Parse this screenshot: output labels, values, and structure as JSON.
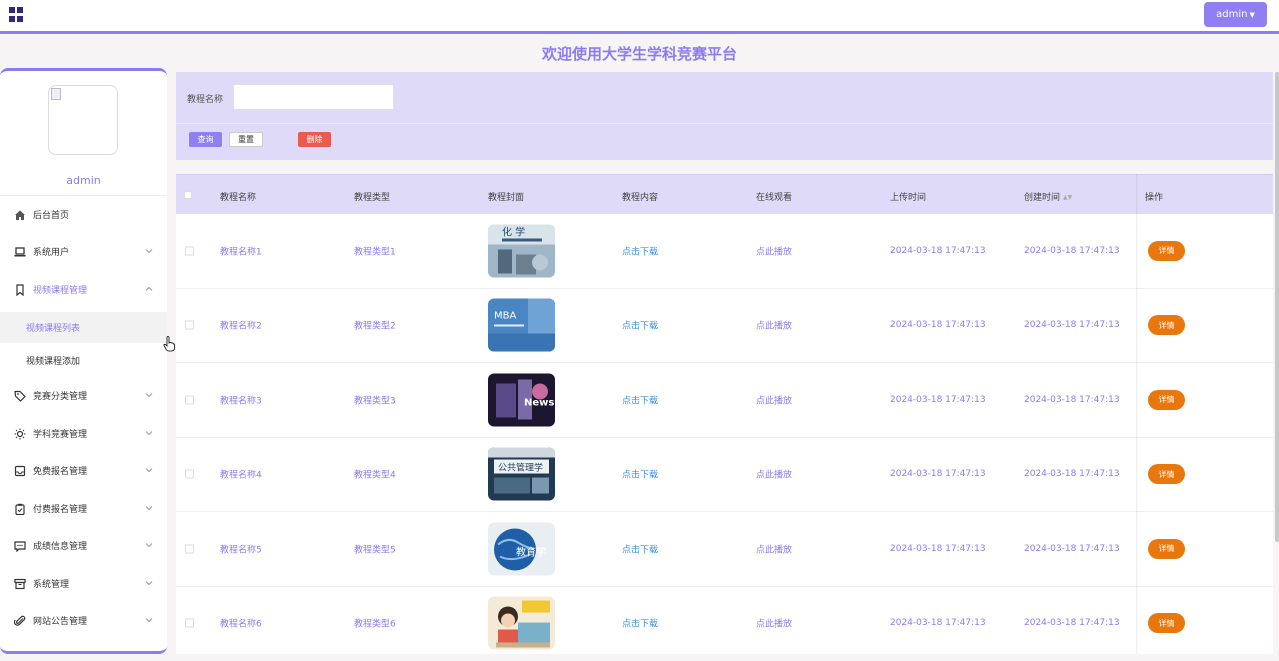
{
  "header": {
    "user_button": "admin",
    "page_title": "欢迎使用大学生学科竞赛平台"
  },
  "sidebar": {
    "username": "admin",
    "items": [
      {
        "label": "后台首页",
        "icon": "home-icon",
        "has_chevron": false
      },
      {
        "label": "系统用户",
        "icon": "laptop-icon",
        "has_chevron": true
      },
      {
        "label": "视频课程管理",
        "icon": "bookmark-icon",
        "has_chevron": true,
        "expanded": true
      },
      {
        "label": "竞赛分类管理",
        "icon": "tag-icon",
        "has_chevron": true
      },
      {
        "label": "学科竞赛管理",
        "icon": "sun-icon",
        "has_chevron": true
      },
      {
        "label": "免费报名管理",
        "icon": "inbox-icon",
        "has_chevron": true
      },
      {
        "label": "付费报名管理",
        "icon": "clipboard-icon",
        "has_chevron": true
      },
      {
        "label": "成绩信息管理",
        "icon": "message-icon",
        "has_chevron": true
      },
      {
        "label": "系统管理",
        "icon": "archive-icon",
        "has_chevron": true
      },
      {
        "label": "网站公告管理",
        "icon": "paperclip-icon",
        "has_chevron": true
      }
    ],
    "subitems": [
      {
        "label": "视频课程列表",
        "current": true
      },
      {
        "label": "视频课程添加",
        "current": false
      }
    ]
  },
  "search": {
    "label": "教程名称",
    "input_value": "",
    "query_label": "查询",
    "reset_label": "重置",
    "delete_label": "删除"
  },
  "table": {
    "headers": [
      "教程名称",
      "教程类型",
      "教程封面",
      "教程内容",
      "在线观看",
      "上传时间",
      "创建时间",
      "操作"
    ],
    "rows": [
      {
        "name": "教程名称1",
        "type": "教程类型1",
        "cover": "chemistry-book-cover",
        "content": "点击下载",
        "watch": "点此播放",
        "upload_time": "2024-03-18 17:47:13",
        "create_time": "2024-03-18 17:47:13",
        "action": "详情"
      },
      {
        "name": "教程名称2",
        "type": "教程类型2",
        "cover": "mba-cover",
        "content": "点击下载",
        "watch": "点此播放",
        "upload_time": "2024-03-18 17:47:13",
        "create_time": "2024-03-18 17:47:13",
        "action": "详情"
      },
      {
        "name": "教程名称3",
        "type": "教程类型3",
        "cover": "news-cover",
        "content": "点击下载",
        "watch": "点此播放",
        "upload_time": "2024-03-18 17:47:13",
        "create_time": "2024-03-18 17:47:13",
        "action": "详情"
      },
      {
        "name": "教程名称4",
        "type": "教程类型4",
        "cover": "public-management-cover",
        "content": "点击下载",
        "watch": "点此播放",
        "upload_time": "2024-03-18 17:47:13",
        "create_time": "2024-03-18 17:47:13",
        "action": "详情"
      },
      {
        "name": "教程名称5",
        "type": "教程类型5",
        "cover": "globe-education-cover",
        "content": "点击下载",
        "watch": "点此播放",
        "upload_time": "2024-03-18 17:47:13",
        "create_time": "2024-03-18 17:47:13",
        "action": "详情"
      },
      {
        "name": "教程名称6",
        "type": "教程类型6",
        "cover": "online-class-cover",
        "content": "点击下载",
        "watch": "点此播放",
        "upload_time": "2024-03-18 17:47:13",
        "create_time": "2024-03-18 17:47:13",
        "action": "详情"
      }
    ]
  },
  "colors": {
    "accent": "#8b7cf0",
    "panel": "#dedaf8",
    "detail": "#e8780d",
    "delete": "#e95b4f",
    "link": "#3a8ee6"
  }
}
